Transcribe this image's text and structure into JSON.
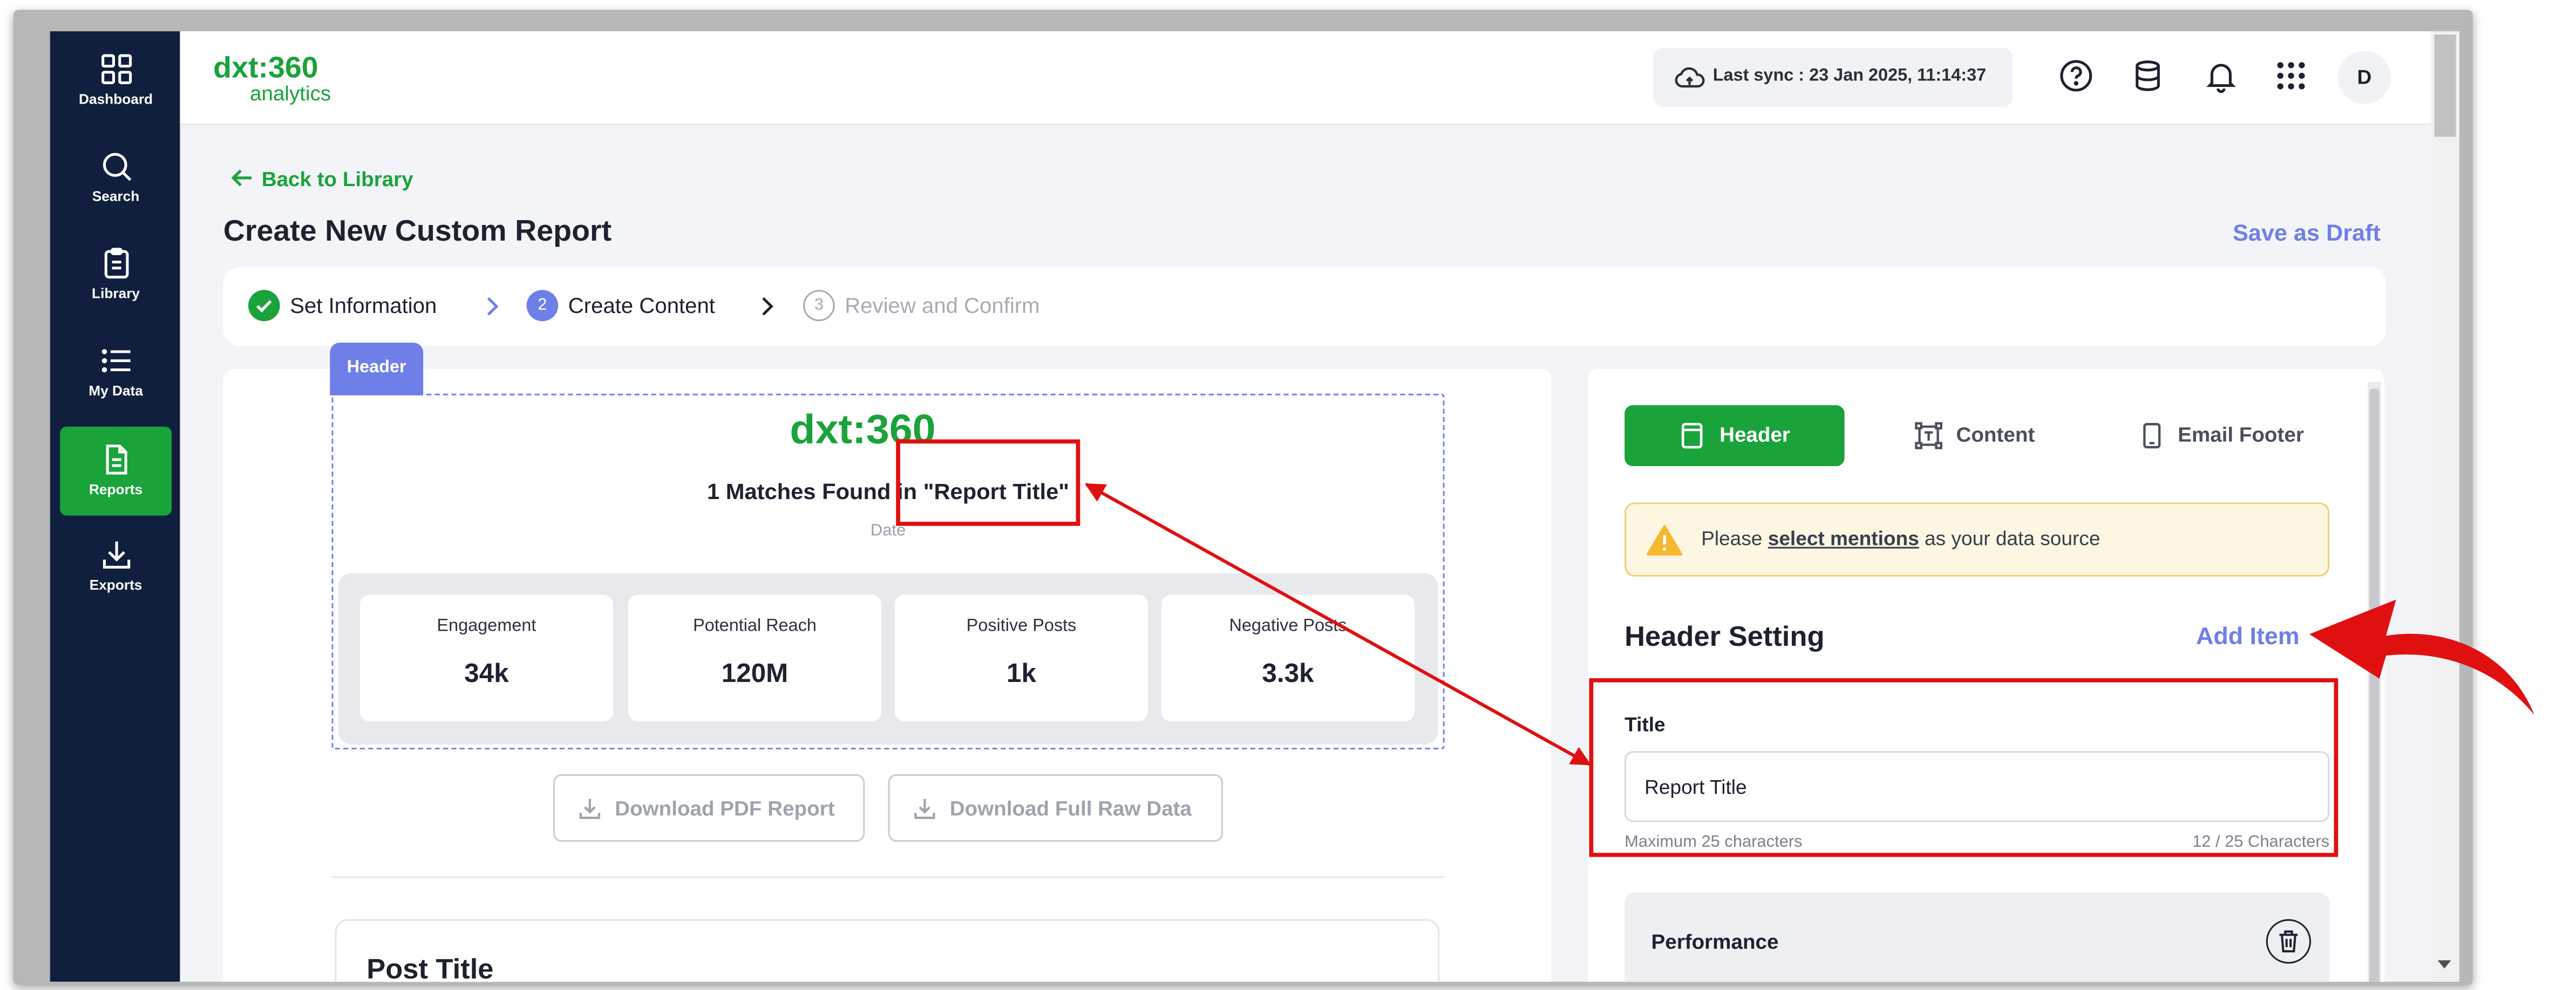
{
  "sidebar": {
    "items": [
      {
        "label": "Dashboard",
        "icon": "grid-icon",
        "active": false
      },
      {
        "label": "Search",
        "icon": "search-icon",
        "active": false
      },
      {
        "label": "Library",
        "icon": "clipboard-icon",
        "active": false
      },
      {
        "label": "My Data",
        "icon": "list-icon",
        "active": false
      },
      {
        "label": "Reports",
        "icon": "document-icon",
        "active": true
      },
      {
        "label": "Exports",
        "icon": "download-icon",
        "active": false
      }
    ]
  },
  "brand": {
    "name": "dxt:360",
    "sub": "analytics",
    "color": "#19a33a"
  },
  "topbar": {
    "sync_text": "Last sync : 23 Jan 2025, 11:14:37",
    "icons": [
      "help-icon",
      "database-icon",
      "bell-icon",
      "apps-grid-icon"
    ],
    "avatar_initial": "D"
  },
  "page": {
    "back_label": "Back to Library",
    "title": "Create New Custom Report",
    "save_draft": "Save as Draft"
  },
  "stepper": {
    "steps": [
      {
        "label": "Set Information",
        "number": "",
        "state": "done"
      },
      {
        "label": "Create Content",
        "number": "2",
        "state": "current"
      },
      {
        "label": "Review and Confirm",
        "number": "3",
        "state": "upcoming"
      }
    ]
  },
  "preview": {
    "section_tag": "Header",
    "logo_text": "dxt:360",
    "matches_prefix": "1 Matches Found in",
    "report_title": "\"Report Title\"",
    "date_label": "Date",
    "stats": [
      {
        "label": "Engagement",
        "value": "34k"
      },
      {
        "label": "Potential Reach",
        "value": "120M"
      },
      {
        "label": "Positive Posts",
        "value": "1k"
      },
      {
        "label": "Negative Posts",
        "value": "3.3k"
      }
    ],
    "download_pdf": "Download PDF Report",
    "download_raw": "Download Full Raw Data",
    "post_title": "Post Title"
  },
  "settings": {
    "tabs": [
      {
        "label": "Header",
        "icon": "page-icon",
        "active": true
      },
      {
        "label": "Content",
        "icon": "text-frame-icon",
        "active": false
      },
      {
        "label": "Email Footer",
        "icon": "mobile-icon",
        "active": false
      }
    ],
    "warning": {
      "before": "Please ",
      "link": "select mentions",
      "after": " as your data source"
    },
    "section_title": "Header Setting",
    "add_item": "Add Item",
    "title_label": "Title",
    "title_value": "Report Title",
    "title_hint": "Maximum 25 characters",
    "title_count": "12 / 25 Characters",
    "performance_label": "Performance"
  },
  "colors": {
    "sidebar_bg": "#0f1f3d",
    "accent_green": "#19a33a",
    "accent_purple": "#6f7fe8",
    "annotation_red": "#e01010"
  }
}
